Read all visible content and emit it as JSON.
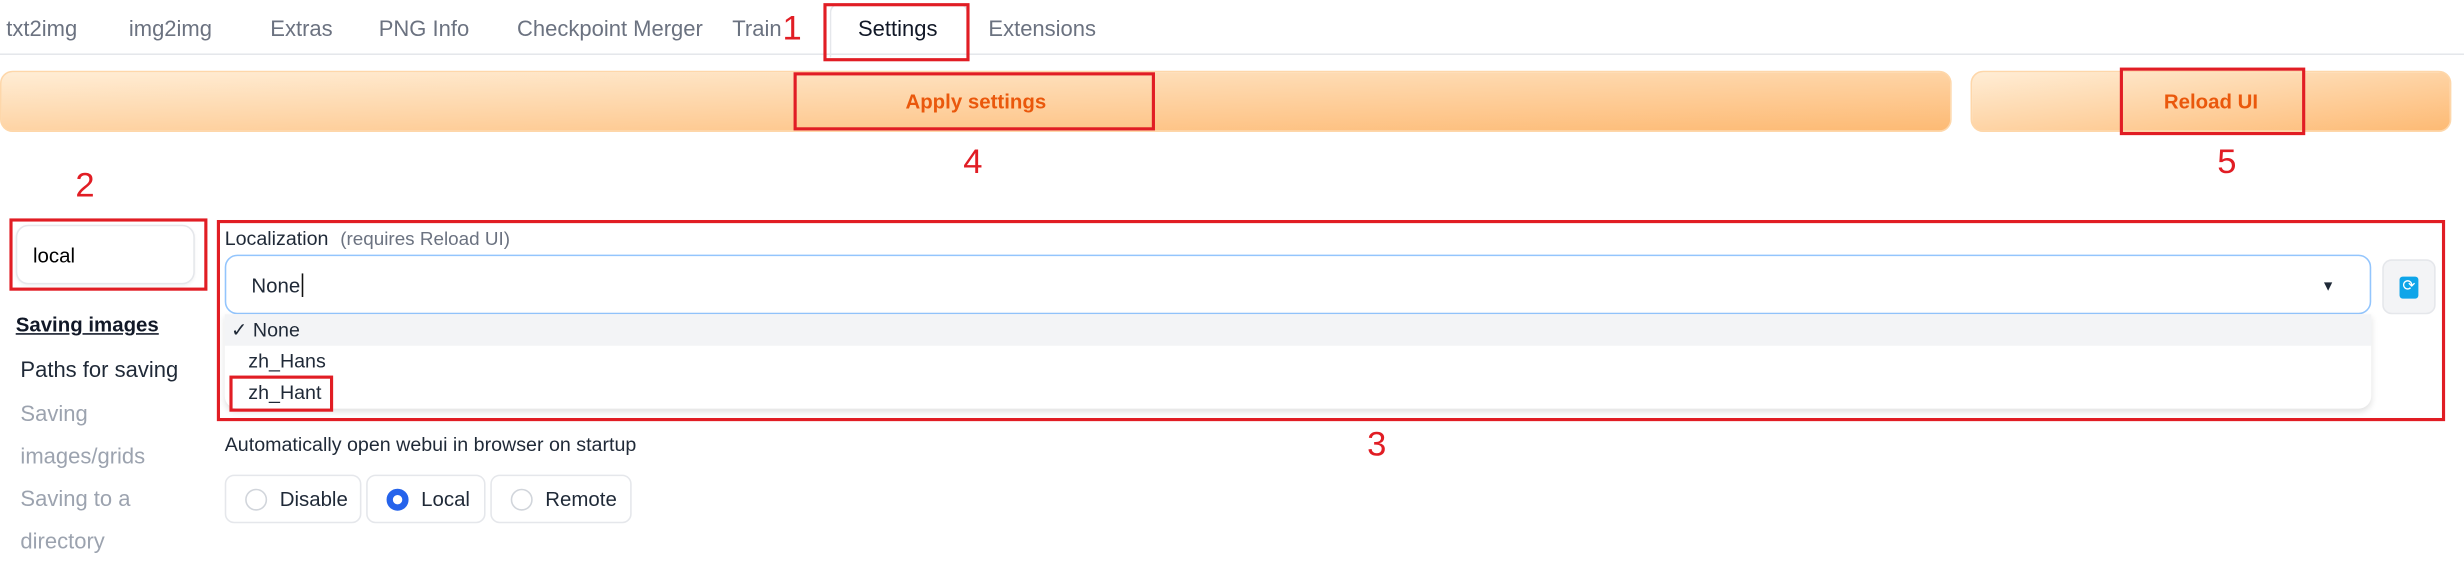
{
  "tabs": [
    {
      "label": "txt2img"
    },
    {
      "label": "img2img"
    },
    {
      "label": "Extras"
    },
    {
      "label": "PNG Info"
    },
    {
      "label": "Checkpoint Merger"
    },
    {
      "label": "Train"
    },
    {
      "label": "Settings",
      "active": true
    },
    {
      "label": "Extensions"
    }
  ],
  "buttons": {
    "apply": "Apply settings",
    "reload": "Reload UI"
  },
  "search": {
    "value": "local"
  },
  "sidebar": {
    "items": [
      {
        "label": "Saving images",
        "active": true
      },
      {
        "label": "Paths for saving"
      },
      {
        "label": "Saving images/grids"
      },
      {
        "label": "Saving to a directory"
      }
    ]
  },
  "localization": {
    "label": "Localization",
    "hint": "(requires Reload UI)",
    "value": "None",
    "options": [
      {
        "label": "✓ None",
        "selected": true
      },
      {
        "label": "zh_Hans"
      },
      {
        "label": "zh_Hant"
      }
    ],
    "refresh_icon": "refresh-icon"
  },
  "autolaunch": {
    "label": "Automatically open webui in browser on startup",
    "options": [
      {
        "label": "Disable"
      },
      {
        "label": "Local",
        "checked": true
      },
      {
        "label": "Remote"
      }
    ]
  },
  "annotations": [
    "1",
    "2",
    "3",
    "4",
    "5"
  ],
  "colors": {
    "accent": "#ea580c",
    "annotation": "#e11d24",
    "radio": "#2563eb"
  }
}
